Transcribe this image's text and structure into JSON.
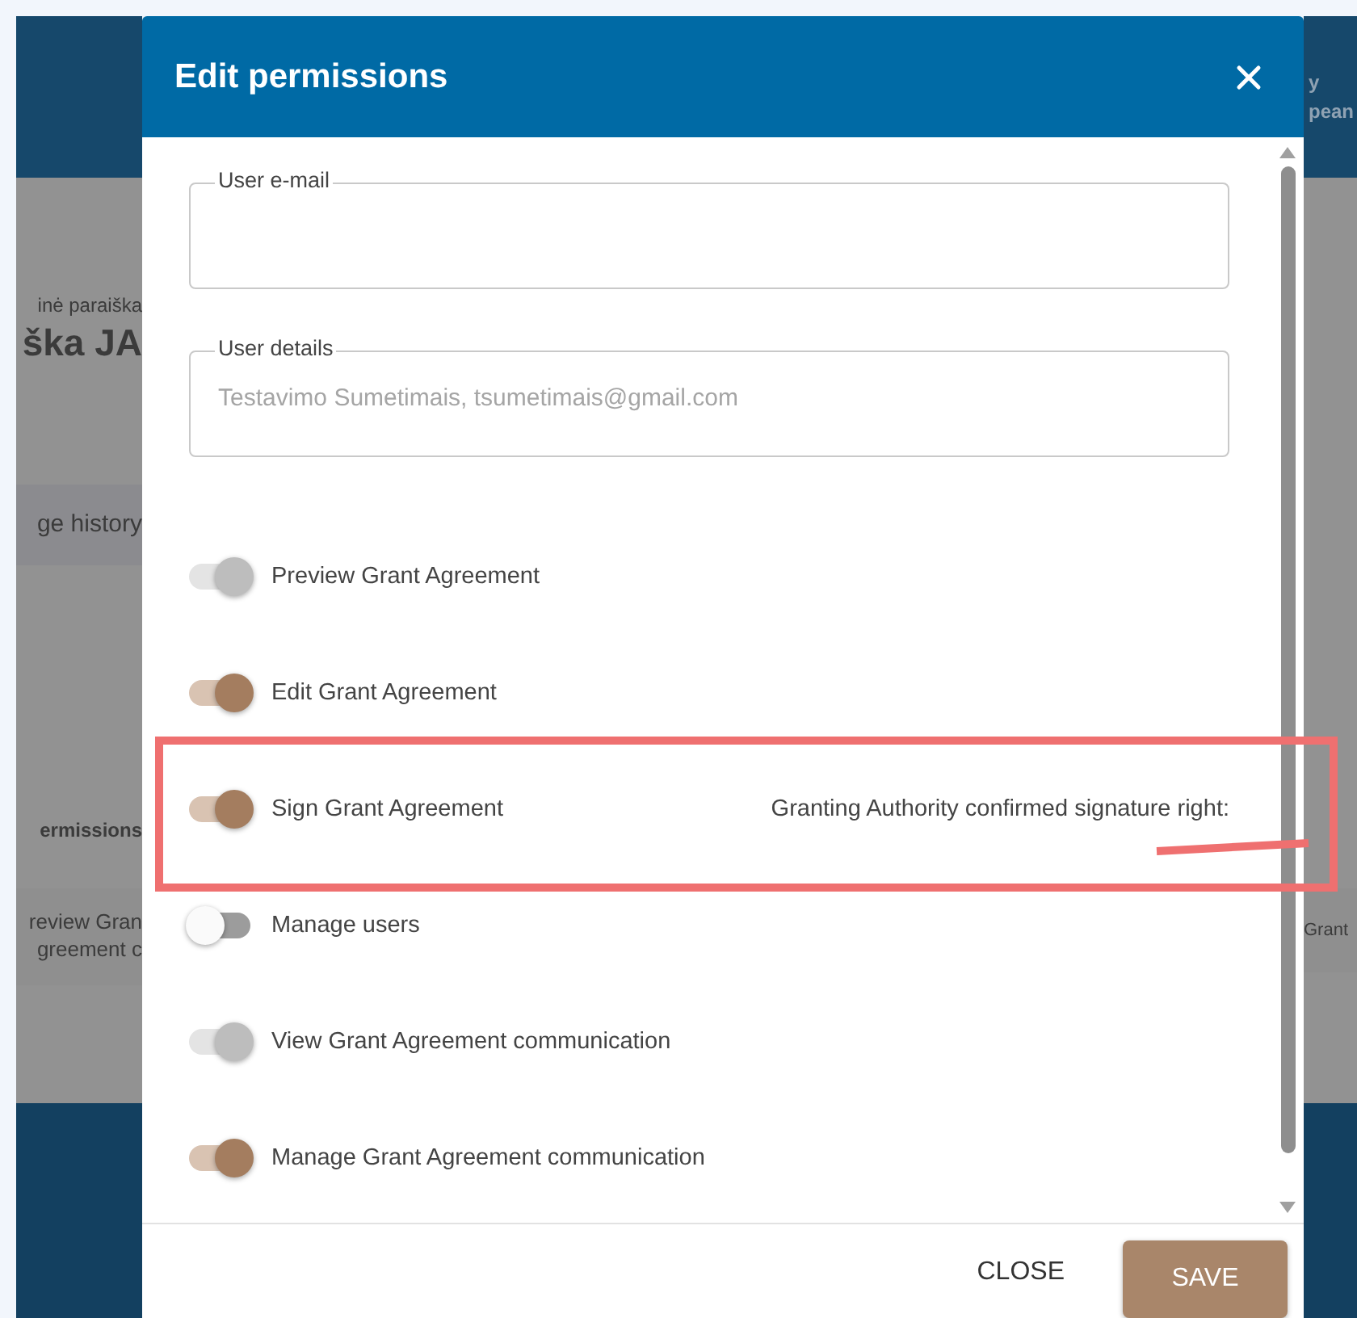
{
  "background": {
    "breadcrumb": "inė paraiška",
    "heading": "ška JA",
    "tab": "ge history",
    "column_header": "ermissions",
    "cell_lines": [
      "review Gran",
      "greement c"
    ],
    "right_header_lines": [
      "y",
      "pean"
    ],
    "right_cell": "Grant"
  },
  "dialog": {
    "title": "Edit permissions",
    "fields": [
      {
        "label": "User e-mail"
      },
      {
        "label": "User details",
        "value": "Testavimo Sumetimais, tsumetimais@gmail.com"
      }
    ],
    "permissions": [
      {
        "label": "Preview Grant Agreement",
        "on": true,
        "disabled": true
      },
      {
        "label": "Edit Grant Agreement",
        "on": true,
        "disabled": false
      },
      {
        "label": "Sign Grant Agreement",
        "on": true,
        "disabled": false,
        "note": "Granting Authority confirmed signature right:"
      },
      {
        "label": "Manage users",
        "on": false,
        "disabled": false
      },
      {
        "label": "View Grant Agreement communication",
        "on": true,
        "disabled": true
      },
      {
        "label": "Manage Grant Agreement communication",
        "on": true,
        "disabled": false
      }
    ],
    "buttons": [
      {
        "label": "CLOSE",
        "kind": "text"
      },
      {
        "label": "SAVE",
        "kind": "filled"
      }
    ]
  },
  "markup": {
    "highlight_frame": true,
    "pen_stroke": true
  }
}
